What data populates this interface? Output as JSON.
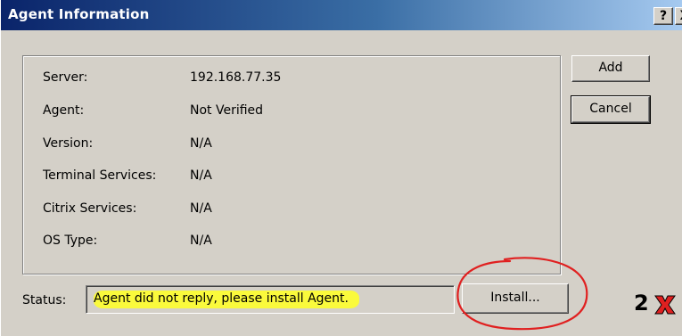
{
  "window": {
    "title": "Agent Information",
    "help_label": "?",
    "close_label": "X"
  },
  "info": {
    "rows": [
      {
        "label": "Server:",
        "value": "192.168.77.35"
      },
      {
        "label": "Agent:",
        "value": "Not Verified"
      },
      {
        "label": "Version:",
        "value": "N/A"
      },
      {
        "label": "Terminal Services:",
        "value": "N/A"
      },
      {
        "label": "Citrix Services:",
        "value": "N/A"
      },
      {
        "label": "OS Type:",
        "value": "N/A"
      }
    ]
  },
  "buttons": {
    "add": "Add",
    "cancel": "Cancel",
    "install": "Install..."
  },
  "status": {
    "label": "Status:",
    "text": "Agent did not reply, please install Agent."
  },
  "logo": {
    "text": "2X",
    "accent_color": "#e02020"
  },
  "colors": {
    "dialog_bg": "#d4d0c8",
    "titlebar_start": "#0a246a",
    "titlebar_end": "#a6caf0",
    "highlight": "#fafa3c",
    "annotation": "#e02020"
  }
}
